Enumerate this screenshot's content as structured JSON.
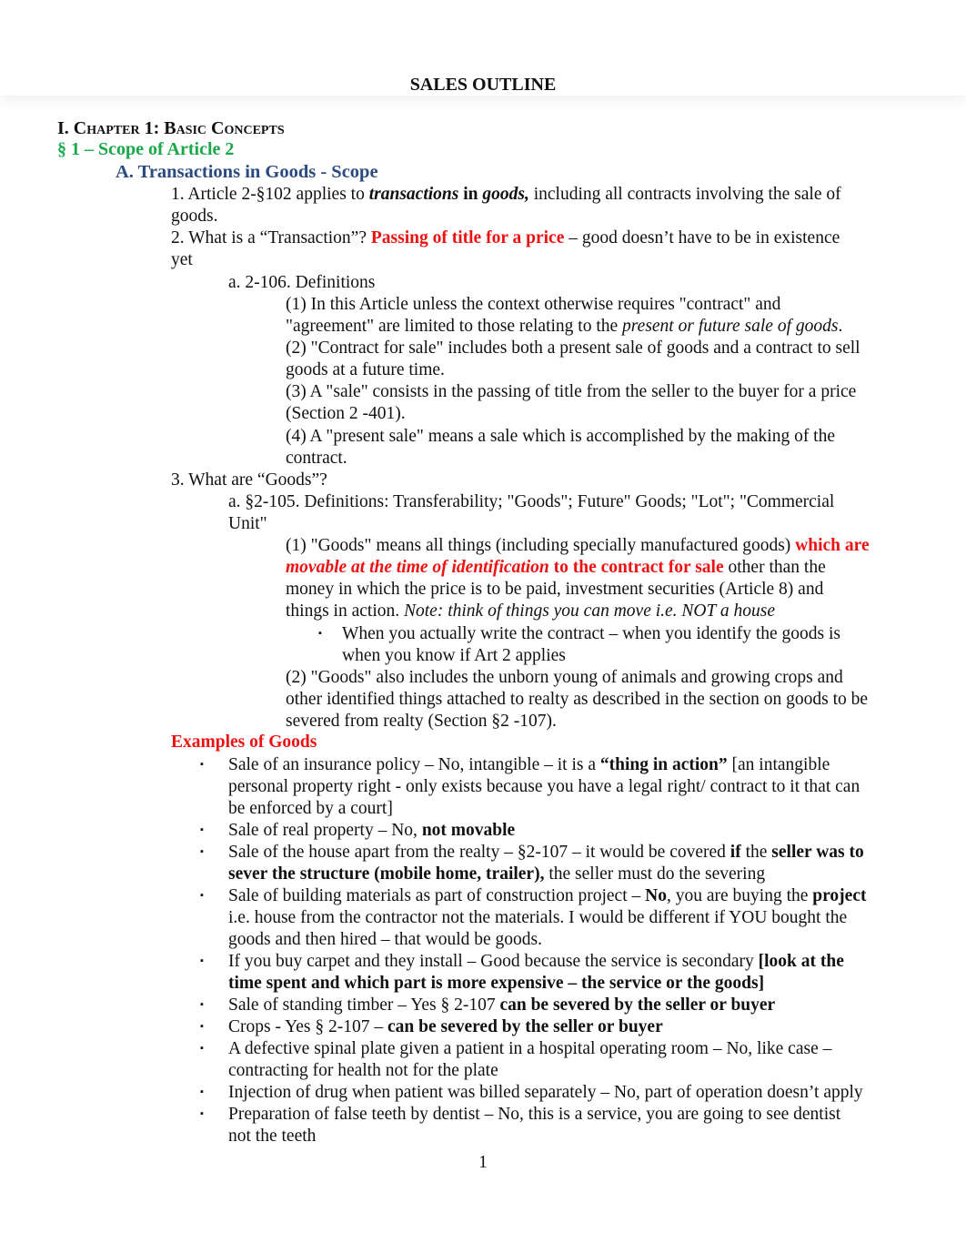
{
  "title": "SALES OUTLINE",
  "chapter": {
    "prefix": "I. ",
    "label": "Chapter 1:  Basic Concepts"
  },
  "section": "§ 1 – Scope of Article 2",
  "subsection": "A. Transactions in Goods - Scope",
  "p1": {
    "a": "1. Article 2-§102 applies to ",
    "b": "transactions",
    "c": " in ",
    "d": "goods,",
    "e": " including all contracts involving the sale of",
    "f": "goods."
  },
  "p2": {
    "a": "2. What is a “Transaction”? ",
    "b": "Passing of title for a price",
    "c": " – good doesn’t have to be in existence",
    "d": "yet"
  },
  "def_2_106": {
    "heading": "a. 2-106. Definitions",
    "d1a": "(1) In this Article unless the context otherwise requires \"contract\" and",
    "d1b": "\"agreement\" are limited to those relating to the ",
    "d1c": "present or future sale of goods",
    "d1d": ".",
    "d2a": "(2) \"Contract for sale\" includes both a present sale of goods and a contract to sell",
    "d2b": "goods at a future time.",
    "d3a": "(3) A \"sale\" consists in the passing of title from the seller to the buyer for a price",
    "d3b": "(Section 2 -401).",
    "d4a": "(4) A \"present sale\" means a sale which is accomplished by the making of the",
    "d4b": "contract."
  },
  "p3": {
    "heading": "3. What are “Goods”?",
    "def_a": "a. §2-105. Definitions:  Transferability; \"Goods\"; Future\" Goods; \"Lot\"; \"Commercial",
    "def_b": "Unit\"",
    "g1a": "(1) \"Goods\" means all things (including specially manufactured goods) ",
    "g1b": "which are",
    "g1c": "movable at the time of identification",
    "g1d": " to the contract for sale",
    "g1e": " other than the",
    "g1f": "money in which the price is to be paid, investment securities (Article 8) and",
    "g1g": "things in action.  ",
    "g1h": "Note: think of things you can move i.e. NOT a house",
    "bullet_a": "When you actually write the contract – when you identify the goods is",
    "bullet_b": "when you know if Art 2 applies",
    "g2a": "(2) \"Goods\" also includes the unborn young of animals and growing crops and",
    "g2b": "other identified things attached to realty as described in the section on goods to be",
    "g2c": "severed from realty (Section §2 -107)."
  },
  "examples": {
    "heading": "Examples of Goods",
    "e1a": "Sale of an insurance policy – No, intangible – it is a ",
    "e1b": "“thing in action”",
    "e1c": " [an intangible",
    "e1d": "personal property right - only exists because you have a legal right/ contract to it that can",
    "e1e": "be enforced by a court]",
    "e2a": "Sale of real property – No, ",
    "e2b": "not movable",
    "e3a": "Sale of the house apart from the realty – §2-107 – it would be covered ",
    "e3b": "if",
    "e3c": " the ",
    "e3d": "seller was to",
    "e3e": "sever the structure (mobile home, trailer),",
    "e3f": " the seller must do the severing",
    "e4a": "Sale of building materials as part of construction project – ",
    "e4b": "No",
    "e4c": ", you are buying the ",
    "e4d": "project",
    "e4e": "i.e. house from the contractor not the materials. I would be different if YOU bought the",
    "e4f": "goods and then hired – that would be goods.",
    "e5a": "If you buy carpet and they install – Good because the service is secondary ",
    "e5b": "[look at the",
    "e5c": "time spent and which part is more expensive – the service or the goods]",
    "e6a": "Sale of standing timber – Yes § 2-107 ",
    "e6b": "can be severed by the seller or buyer",
    "e7a": "Crops - Yes § 2-107 – ",
    "e7b": "can be severed by the seller or buyer",
    "e8a": "A defective spinal plate given a patient in a hospital operating room – No, like case –",
    "e8b": "contracting for health not for the plate",
    "e9": "Injection of drug when patient was billed separately – No, part of operation doesn’t apply",
    "e10a": "Preparation of false teeth by dentist – No, this is a service, you are going to see dentist",
    "e10b": "not the teeth"
  },
  "bullet_glyph": "▪",
  "page_number": "1"
}
